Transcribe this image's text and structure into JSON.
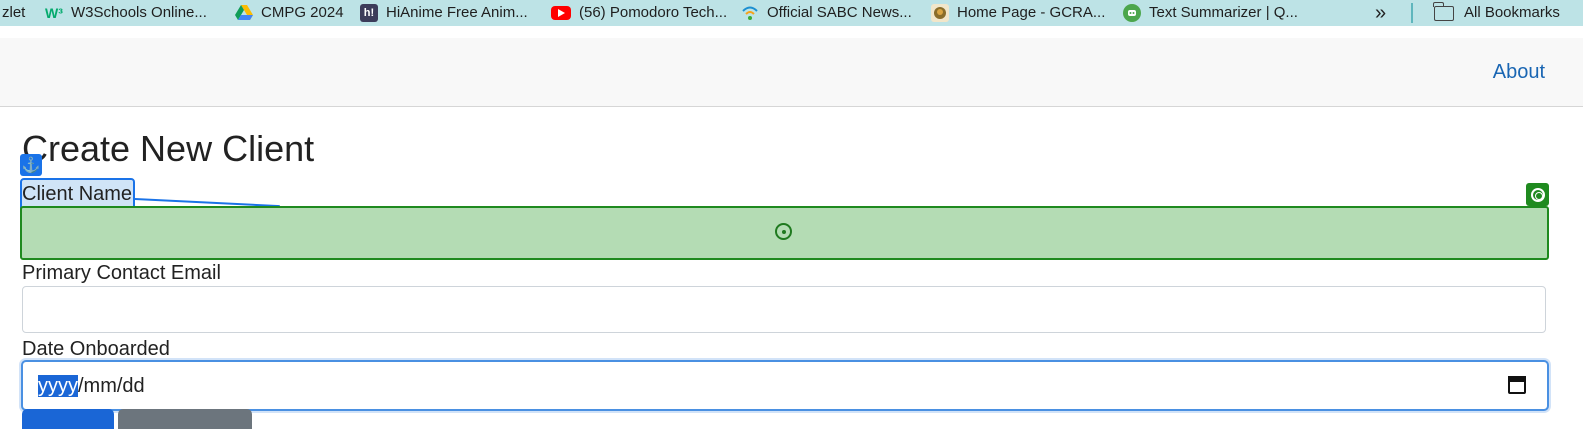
{
  "bookmarks": {
    "items": [
      {
        "label": "zlet",
        "icon": "quizlet-icon"
      },
      {
        "label": "W3Schools Online...",
        "icon": "w3schools-icon"
      },
      {
        "label": "CMPG 2024",
        "icon": "google-drive-icon"
      },
      {
        "label": "HiAnime Free Anim...",
        "icon": "hianime-icon"
      },
      {
        "label": "(56) Pomodoro Tech...",
        "icon": "youtube-icon"
      },
      {
        "label": "Official SABC News...",
        "icon": "sabc-icon"
      },
      {
        "label": "Home Page - GCRA...",
        "icon": "gcra-icon"
      },
      {
        "label": "Text Summarizer | Q...",
        "icon": "quillbot-icon"
      }
    ],
    "overflow": "»",
    "all_bookmarks": "All Bookmarks"
  },
  "navbar": {
    "about": "About"
  },
  "form": {
    "title": "Create New Client",
    "client_name_label": "Client Name",
    "email_label": "Primary Contact Email",
    "date_label": "Date Onboarded",
    "date_value_selected": "yyyy",
    "date_value_rest": "/mm/dd"
  },
  "colors": {
    "bookmarks_bg": "#bde3e6",
    "link": "#1a66b3",
    "highlight_blue": "#1a73e8",
    "highlight_green": "#1f8a1f"
  }
}
